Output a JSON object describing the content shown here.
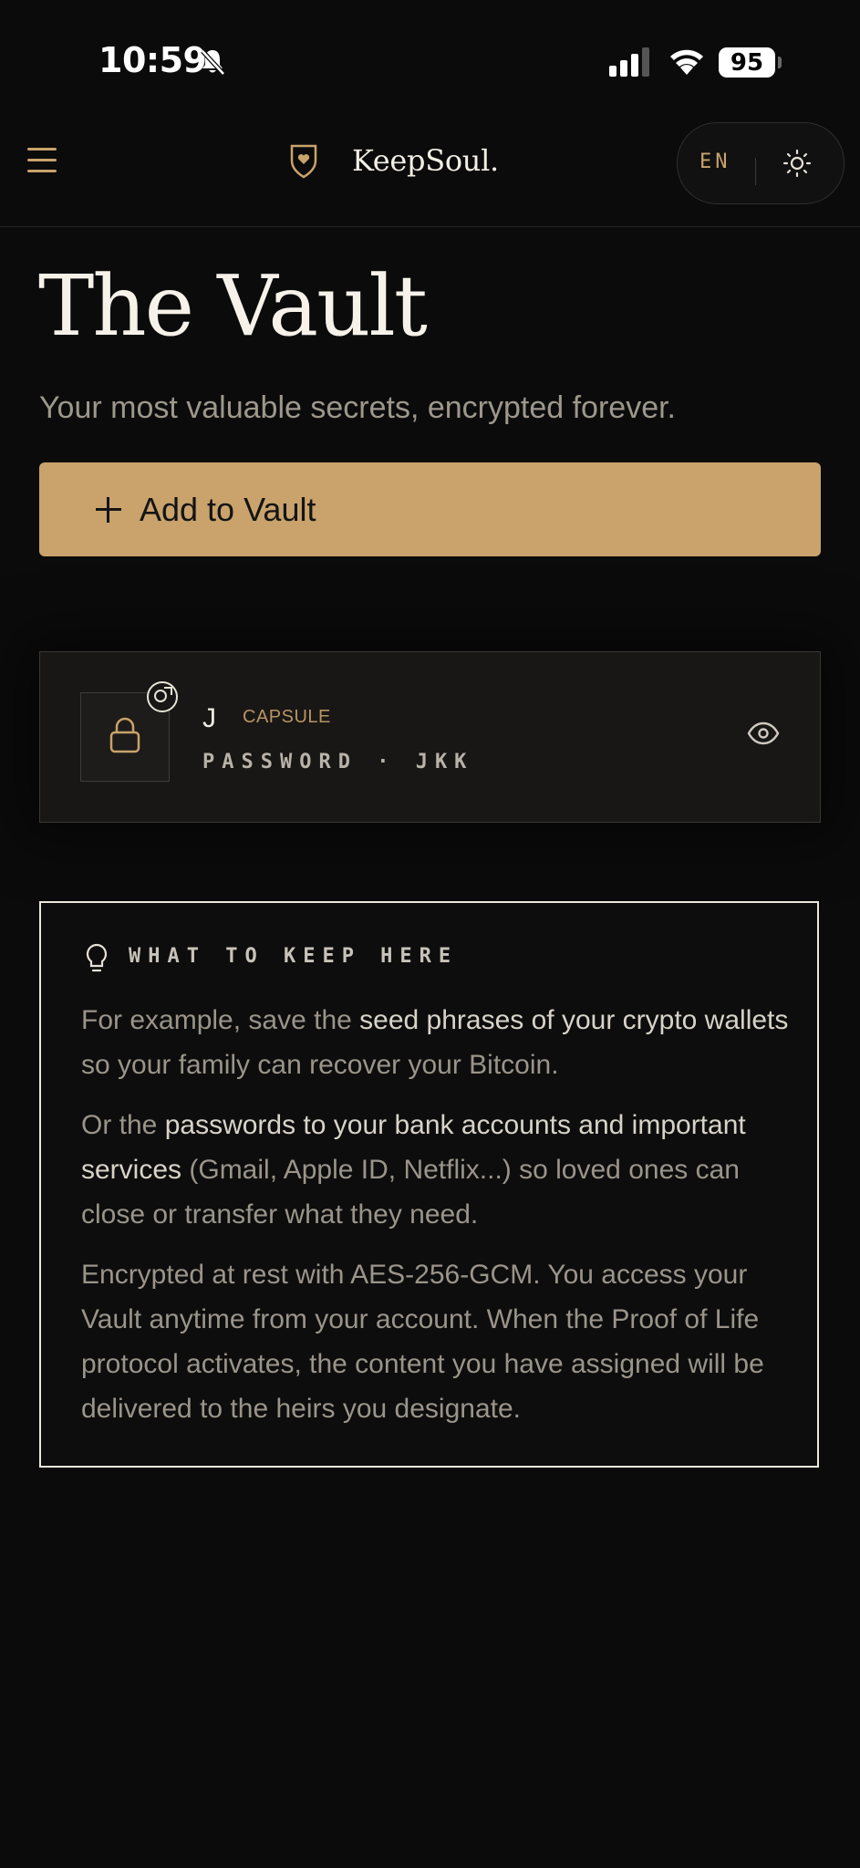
{
  "status_bar": {
    "time": "10:59",
    "battery": "95",
    "icons": [
      "bell-slash-icon",
      "cellular-signal-icon",
      "wifi-icon",
      "battery-icon"
    ]
  },
  "header": {
    "brand_name": "KeepSoul.",
    "brand_icon": "shield-heart-icon",
    "language": "EN",
    "theme_icon": "sun-icon",
    "menu_icon": "hamburger-menu-icon"
  },
  "page": {
    "title": "The Vault",
    "subtitle": "Your most valuable secrets, encrypted forever."
  },
  "add_button": {
    "label": "Add to Vault",
    "icon": "plus-icon"
  },
  "vault_items": [
    {
      "name": "J",
      "tag": "CAPSULE",
      "meta": "PASSWORD · JKK",
      "icon": "lock-icon",
      "badge_icon": "gender-male-icon",
      "action_icon": "eye-icon"
    }
  ],
  "tips": {
    "icon": "lightbulb-icon",
    "heading": "WHAT TO KEEP HERE",
    "p1_pre": "For example, save the ",
    "p1_strong": "seed phrases of your crypto wallets",
    "p1_post": " so your family can recover your Bitcoin.",
    "p2_pre": "Or the ",
    "p2_strong": "passwords to your bank accounts and important services",
    "p2_post": " (Gmail, Apple ID, Netflix...) so loved ones can close or transfer what they need.",
    "p3": "Encrypted at rest with AES-256-GCM. You access your Vault anytime from your account. When the Proof of Life protocol activates, the content you have assigned will be delivered to the heirs you designate."
  },
  "colors": {
    "background": "#0b0b0b",
    "accent_gold": "#c9a36b",
    "card": "#181716",
    "text_primary": "#f3efe6",
    "text_muted": "#9a948a"
  }
}
